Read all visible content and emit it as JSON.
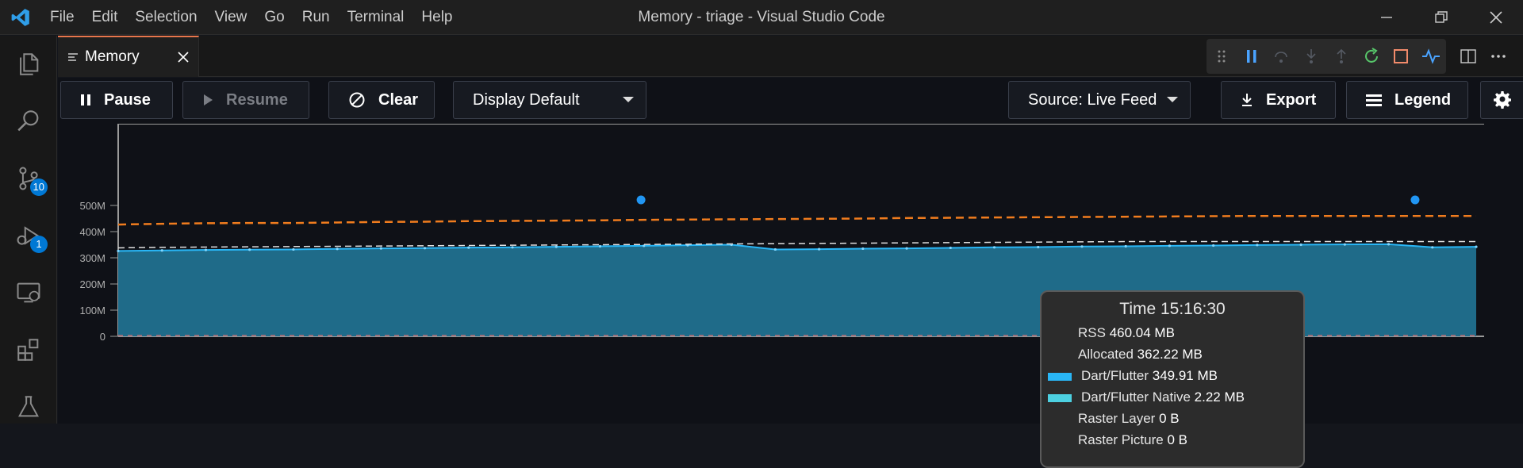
{
  "window": {
    "title": "Memory - triage - Visual Studio Code",
    "menu": [
      "File",
      "Edit",
      "Selection",
      "View",
      "Go",
      "Run",
      "Terminal",
      "Help"
    ]
  },
  "activity_bar": {
    "items": [
      {
        "name": "explorer-icon"
      },
      {
        "name": "search-icon"
      },
      {
        "name": "source-control-icon",
        "badge": "10"
      },
      {
        "name": "run-debug-icon",
        "badge": "1"
      },
      {
        "name": "remote-explorer-icon"
      },
      {
        "name": "extensions-icon"
      },
      {
        "name": "testing-icon"
      }
    ]
  },
  "tab": {
    "label": "Memory"
  },
  "toolbar": {
    "pause": "Pause",
    "resume": "Resume",
    "clear": "Clear",
    "display": "Display Default",
    "source": "Source: Live Feed",
    "export": "Export",
    "legend": "Legend"
  },
  "chart_data": {
    "type": "area",
    "y_ticks": [
      "0",
      "100M",
      "200M",
      "300M",
      "400M",
      "500M"
    ],
    "ylim": [
      0,
      500
    ],
    "unit": "MB",
    "series": [
      {
        "name": "RSS",
        "style": "dashed",
        "color": "#f07c1e",
        "values": [
          427,
          430,
          432,
          433,
          433,
          435,
          437,
          438,
          440,
          441,
          442,
          443,
          445,
          446,
          447,
          448,
          449,
          450,
          452,
          453,
          454,
          455,
          456,
          457,
          458,
          459,
          460,
          460,
          460,
          460,
          460,
          460
        ]
      },
      {
        "name": "Allocated",
        "style": "dashed",
        "color": "#e0e0e0",
        "values": [
          338,
          340,
          341,
          342,
          343,
          344,
          345,
          346,
          347,
          348,
          349,
          350,
          351,
          352,
          353,
          354,
          355,
          356,
          357,
          358,
          359,
          360,
          361,
          362,
          362,
          362,
          362,
          362,
          362,
          362,
          362,
          362
        ]
      },
      {
        "name": "Dart/Flutter",
        "style": "area",
        "color": "#29b6f6",
        "values": [
          326,
          328,
          330,
          331,
          332,
          334,
          336,
          337,
          339,
          340,
          342,
          344,
          346,
          348,
          350,
          332,
          333,
          335,
          336,
          338,
          340,
          341,
          343,
          344,
          346,
          347,
          349,
          350,
          351,
          352,
          340,
          342
        ]
      },
      {
        "name": "Dart/Flutter Native",
        "style": "area",
        "color": "#4dd0e1",
        "values": [
          2.22
        ]
      },
      {
        "name": "Raster Layer",
        "style": "line",
        "color": "#e57373",
        "values": [
          0
        ]
      },
      {
        "name": "Raster Picture",
        "style": "line",
        "color": "#e57373",
        "values": [
          0
        ]
      }
    ],
    "gc_events": [
      0.385,
      0.955
    ]
  },
  "tooltip": {
    "title": "Time 15:16:30",
    "rows": [
      {
        "label": "RSS",
        "value": "460.04 MB"
      },
      {
        "label": "Allocated",
        "value": "362.22 MB"
      },
      {
        "label": "Dart/Flutter",
        "value": "349.91 MB",
        "swatch": "#29b6f6"
      },
      {
        "label": "Dart/Flutter Native",
        "value": "2.22 MB",
        "swatch": "#4dd0e1"
      },
      {
        "label": "Raster Layer",
        "value": "0 B"
      },
      {
        "label": "Raster Picture",
        "value": "0 B"
      }
    ]
  },
  "colors": {
    "accent": "#0078d4",
    "tab_border": "#e7764b"
  }
}
